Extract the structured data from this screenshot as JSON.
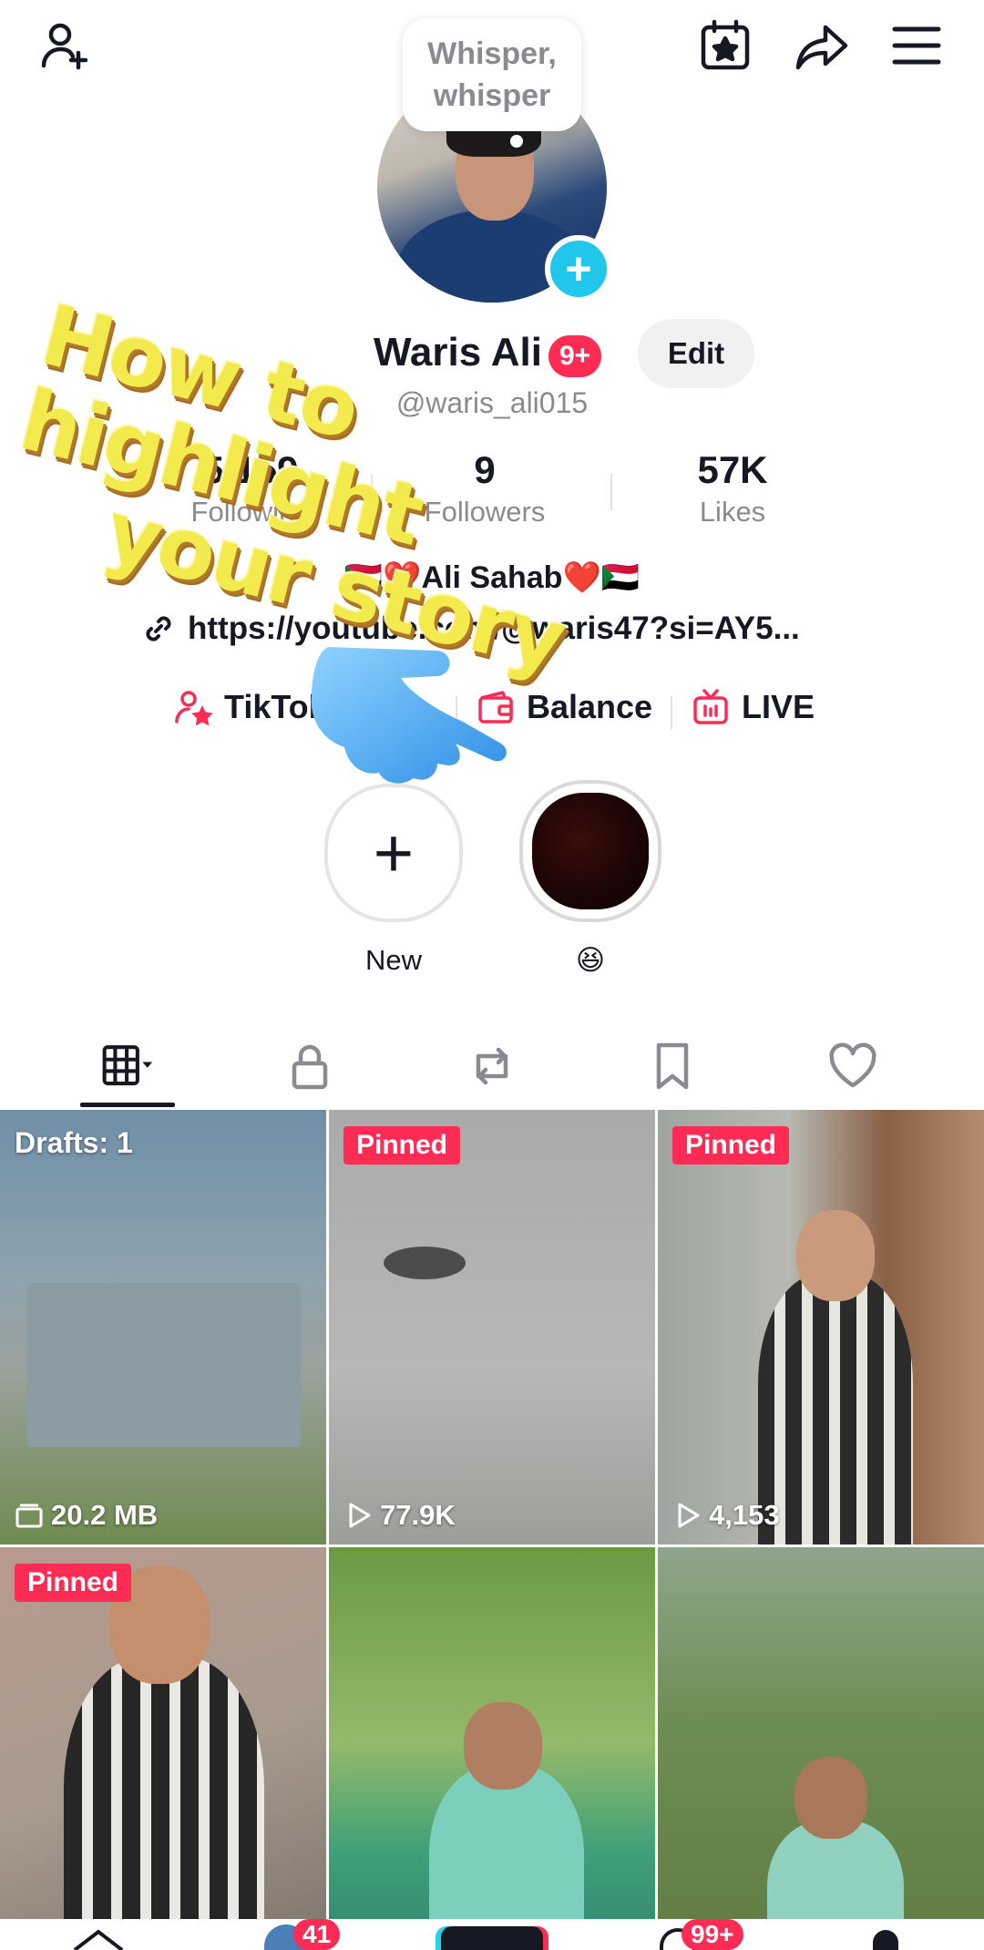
{
  "note": {
    "text": "Whisper, whisper"
  },
  "profile": {
    "name": "Waris Ali",
    "notification_badge": "9+",
    "edit_label": "Edit",
    "username": "@waris_ali015",
    "stats": [
      {
        "value": "5,159",
        "label": "Following"
      },
      {
        "value": "9",
        "label": "Followers"
      },
      {
        "value": "57K",
        "label": "Likes"
      }
    ],
    "bio": "🇸🇩❤️Ali Sahab❤️🇸🇩",
    "link": "https://youtube.com/@waris47?si=AY5..."
  },
  "actions": [
    {
      "label": "TikTok",
      "icon": "person-star-icon"
    },
    {
      "label": "Balance",
      "icon": "wallet-icon"
    },
    {
      "label": "LIVE",
      "icon": "live-tv-icon"
    }
  ],
  "highlights": [
    {
      "label": "New"
    },
    {
      "label": "😆"
    }
  ],
  "tabs": [
    "videos-grid",
    "private",
    "reposts",
    "favorites",
    "liked"
  ],
  "videos": [
    {
      "overlay": "Drafts: 1",
      "meta": "20.2 MB",
      "type": "drafts"
    },
    {
      "overlay": "Pinned",
      "meta": "77.9K",
      "type": "pinned"
    },
    {
      "overlay": "Pinned",
      "meta": "4,153",
      "type": "pinned"
    },
    {
      "overlay": "Pinned",
      "meta": "",
      "type": "pinned"
    },
    {
      "overlay": "",
      "meta": "",
      "type": "video"
    },
    {
      "overlay": "",
      "meta": "",
      "type": "video"
    }
  ],
  "bottom_nav": {
    "inbox_badge": "41",
    "profile_badge": "99+"
  },
  "overlay_caption": {
    "line1": "How to highlight",
    "line2": "your story"
  },
  "colors": {
    "accent": "#fe2c55",
    "plus_blue": "#20c7ea",
    "caption_yellow": "#f3ea4e"
  }
}
